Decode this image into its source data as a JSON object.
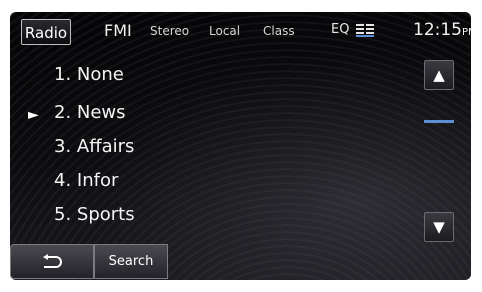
{
  "topbar": {
    "source_tab": "Radio",
    "band": "FMI",
    "stereo": "Stereo",
    "local": "Local",
    "class": "Class",
    "eq": "EQ",
    "eq_icon": "equalizer-icon",
    "clock_time": "12:15",
    "clock_ampm": "PM"
  },
  "presets": [
    {
      "label": "1. None"
    },
    {
      "label": "2. News",
      "selected": true
    },
    {
      "label": "3. Affairs"
    },
    {
      "label": "4. Infor"
    },
    {
      "label": "5. Sports"
    }
  ],
  "scroll": {
    "up_icon": "triangle-up-icon",
    "down_icon": "triangle-down-icon",
    "up_glyph": "▲",
    "down_glyph": "▼"
  },
  "selector": {
    "glyph": "►",
    "icon": "selected-arrow-icon"
  },
  "bottom": {
    "back_icon": "back-arrow-icon",
    "search_label": "Search"
  },
  "colors": {
    "accent": "#5d8fd6",
    "text": "#f4f4f4",
    "background": "#0b0b0e"
  }
}
